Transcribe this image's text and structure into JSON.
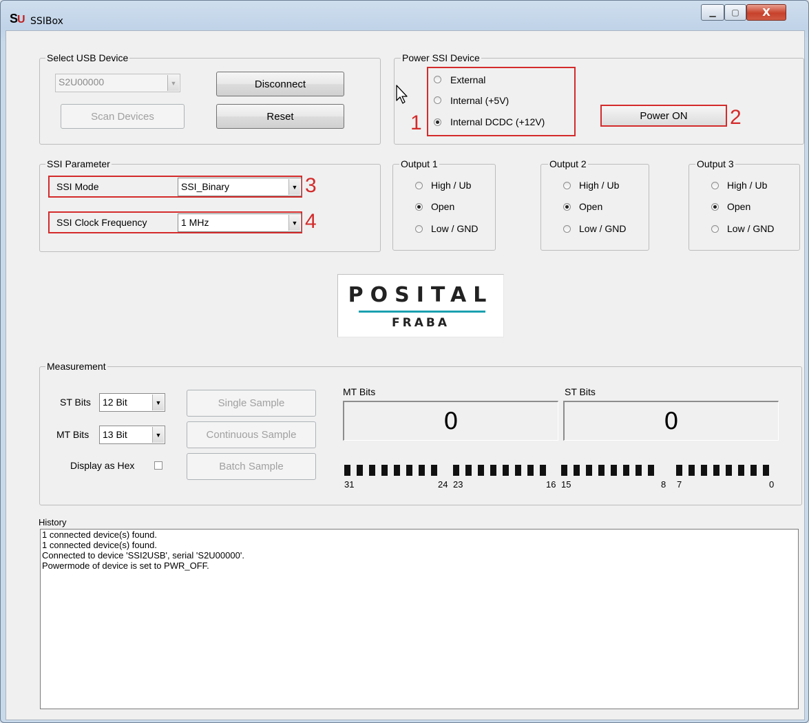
{
  "window": {
    "title": "SSIBox",
    "icon_letters": {
      "s": "S",
      "u": "U"
    },
    "minimize_glyph": "▁",
    "maximize_glyph": "▢",
    "close_glyph": "X"
  },
  "usb": {
    "legend": "Select USB Device",
    "device_value": "S2U00000",
    "disconnect_label": "Disconnect",
    "scan_label": "Scan Devices",
    "reset_label": "Reset"
  },
  "power": {
    "legend": "Power SSI Device",
    "options": [
      "External",
      "Internal (+5V)",
      "Internal DCDC (+12V)"
    ],
    "selected": "Internal DCDC (+12V)",
    "power_button_label": "Power ON",
    "marker_1": "1",
    "marker_2": "2"
  },
  "ssi": {
    "legend": "SSI Parameter",
    "mode_label": "SSI Mode",
    "mode_value": "SSI_Binary",
    "clock_label": "SSI Clock Frequency",
    "clock_value": "1 MHz",
    "marker_3": "3",
    "marker_4": "4"
  },
  "outputs": [
    {
      "legend": "Output 1",
      "options": [
        "High / Ub",
        "Open",
        "Low / GND"
      ],
      "selected": "Open"
    },
    {
      "legend": "Output 2",
      "options": [
        "High / Ub",
        "Open",
        "Low / GND"
      ],
      "selected": "Open"
    },
    {
      "legend": "Output 3",
      "options": [
        "High / Ub",
        "Open",
        "Low / GND"
      ],
      "selected": "Open"
    }
  ],
  "logo": {
    "brand": "POSITAL",
    "sub": "FRABA",
    "underline_color": "#1aa0b0"
  },
  "measurement": {
    "legend": "Measurement",
    "st_bits_label": "ST Bits",
    "st_bits_value": "12 Bit",
    "mt_bits_label": "MT Bits",
    "mt_bits_value": "13 Bit",
    "hex_label": "Display as Hex",
    "single_label": "Single Sample",
    "continuous_label": "Continuous Sample",
    "batch_label": "Batch Sample",
    "mt_display_label": "MT Bits",
    "mt_display_value": "0",
    "st_display_label": "ST Bits",
    "st_display_value": "0",
    "bit_groups": [
      {
        "high": "31",
        "low": "24"
      },
      {
        "high": "23",
        "low": "16"
      },
      {
        "high": "15",
        "low": "8"
      },
      {
        "high": "7",
        "low": "0"
      }
    ]
  },
  "history": {
    "label": "History",
    "lines": [
      "1 connected device(s) found.",
      "1 connected device(s) found.",
      "Connected to device 'SSI2USB', serial 'S2U00000'.",
      "Powermode of device is set to PWR_OFF."
    ]
  },
  "colors": {
    "annotation_red": "#d42a2a",
    "window_bg": "#f0f0f0"
  }
}
